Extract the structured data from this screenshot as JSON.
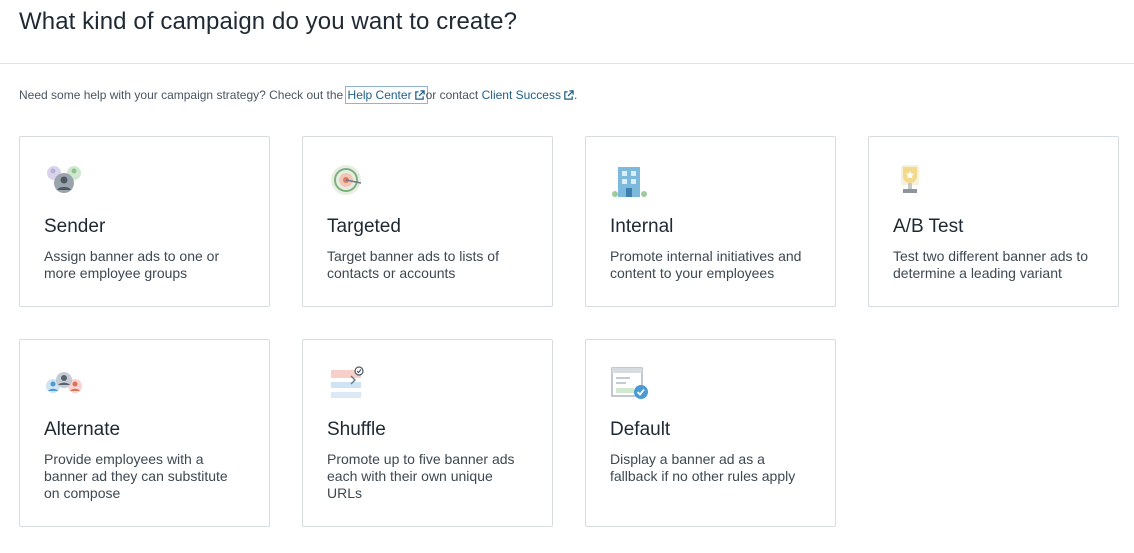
{
  "header": {
    "title": "What kind of campaign do you want to create?"
  },
  "help": {
    "prefix": "Need some help with your campaign strategy? Check out the",
    "help_center_label": "Help Center",
    "middle": "or contact",
    "client_success_label": "Client Success",
    "suffix": "."
  },
  "cards": [
    {
      "title": "Sender",
      "description": "Assign banner ads to one or more employee groups",
      "icon": "people-group-icon"
    },
    {
      "title": "Targeted",
      "description": "Target banner ads to lists of contacts or accounts",
      "icon": "target-icon"
    },
    {
      "title": "Internal",
      "description": "Promote internal initiatives and content to your employees",
      "icon": "building-icon"
    },
    {
      "title": "A/B Test",
      "description": "Test two different banner ads to determine a leading variant",
      "icon": "trophy-icon"
    },
    {
      "title": "Alternate",
      "description": "Provide employees with a banner ad they can substitute on compose",
      "icon": "people-swap-icon"
    },
    {
      "title": "Shuffle",
      "description": "Promote up to five banner ads each with their own unique URLs",
      "icon": "stacked-banners-icon"
    },
    {
      "title": "Default",
      "description": "Display a banner ad as a fallback if no other rules apply",
      "icon": "window-check-icon"
    }
  ]
}
